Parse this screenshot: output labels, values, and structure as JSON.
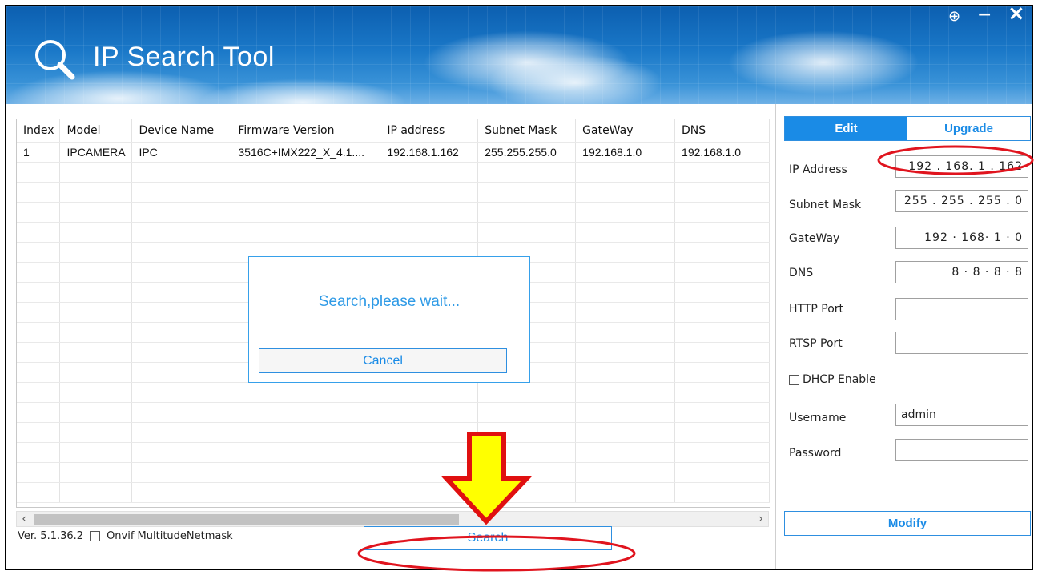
{
  "app": {
    "title": "IP Search Tool",
    "window_controls": {
      "add": "⊕",
      "minimize": "−",
      "close": "×"
    }
  },
  "table": {
    "columns": [
      "Index",
      "Model",
      "Device Name",
      "Firmware Version",
      "IP address",
      "Subnet Mask",
      "GateWay",
      "DNS"
    ],
    "rows": [
      [
        "1",
        "IPCAMERA",
        "IPC",
        "3516C+IMX222_X_4.1....",
        "192.168.1.162",
        "255.255.255.0",
        "192.168.1.0",
        "192.168.1.0"
      ]
    ],
    "empty_row_count": 17
  },
  "scrollbar": {
    "left_arrow": "‹",
    "right_arrow": "›"
  },
  "dialog": {
    "message": "Search,please wait...",
    "cancel_label": "Cancel"
  },
  "status_bar": {
    "version": "Ver. 5.1.36.2",
    "onvif_label": "Onvif MultitudeNetmask",
    "onvif_checked": false
  },
  "search_label": "Search",
  "panel": {
    "tabs": [
      {
        "label": "Edit",
        "active": true
      },
      {
        "label": "Upgrade",
        "active": false
      }
    ],
    "fields": {
      "ip_address": {
        "label": "IP Address",
        "value": "192 . 168.  1  . 162"
      },
      "subnet_mask": {
        "label": "Subnet Mask",
        "value": "255 . 255 . 255 .  0"
      },
      "gateway": {
        "label": "GateWay",
        "value": "192 · 168·  1  ·  0"
      },
      "dns": {
        "label": "DNS",
        "value": "8  ·  8   ·  8  ·  8"
      },
      "http_port": {
        "label": "HTTP Port",
        "value": ""
      },
      "rtsp_port": {
        "label": "RTSP Port",
        "value": ""
      },
      "username": {
        "label": "Username",
        "value": "admin"
      },
      "password": {
        "label": "Password",
        "value": ""
      }
    },
    "dhcp_label": "DHCP Enable",
    "dhcp_checked": false,
    "modify_label": "Modify"
  },
  "colors": {
    "accent": "#1a8be6",
    "header_dark": "#0c5fb0",
    "highlight_ring": "#e0141e",
    "arrow_fill": "#ffff00",
    "arrow_stroke": "#e01010"
  }
}
